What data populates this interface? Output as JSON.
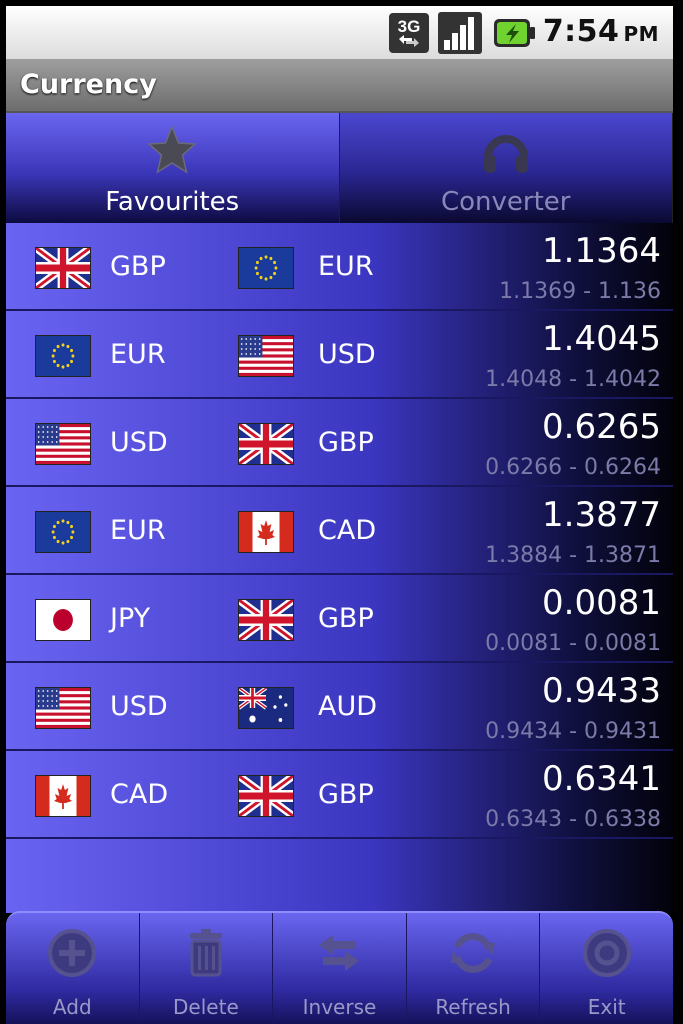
{
  "status_bar": {
    "network": "3G",
    "time": "7:54",
    "ampm": "PM"
  },
  "app": {
    "title": "Currency"
  },
  "tabs": [
    {
      "label": "Favourites",
      "icon": "star-icon",
      "active": true
    },
    {
      "label": "Converter",
      "icon": "converter-icon",
      "active": false
    }
  ],
  "rows": [
    {
      "from": "GBP",
      "to": "EUR",
      "rate": "1.1364",
      "range": "1.1369 - 1.136"
    },
    {
      "from": "EUR",
      "to": "USD",
      "rate": "1.4045",
      "range": "1.4048 - 1.4042"
    },
    {
      "from": "USD",
      "to": "GBP",
      "rate": "0.6265",
      "range": "0.6266 - 0.6264"
    },
    {
      "from": "EUR",
      "to": "CAD",
      "rate": "1.3877",
      "range": "1.3884 - 1.3871"
    },
    {
      "from": "JPY",
      "to": "GBP",
      "rate": "0.0081",
      "range": "0.0081 - 0.0081"
    },
    {
      "from": "USD",
      "to": "AUD",
      "rate": "0.9433",
      "range": "0.9434 - 0.9431"
    },
    {
      "from": "CAD",
      "to": "GBP",
      "rate": "0.6341",
      "range": "0.6343 - 0.6338"
    }
  ],
  "menu": [
    {
      "label": "Add",
      "icon": "add-icon"
    },
    {
      "label": "Delete",
      "icon": "trash-icon"
    },
    {
      "label": "Inverse",
      "icon": "swap-icon"
    },
    {
      "label": "Refresh",
      "icon": "refresh-icon"
    },
    {
      "label": "Exit",
      "icon": "exit-icon"
    }
  ],
  "colors": {
    "accent": "#5a55e0",
    "row_divider": "#1a1860",
    "secondary_text": "#7c7aa8"
  }
}
